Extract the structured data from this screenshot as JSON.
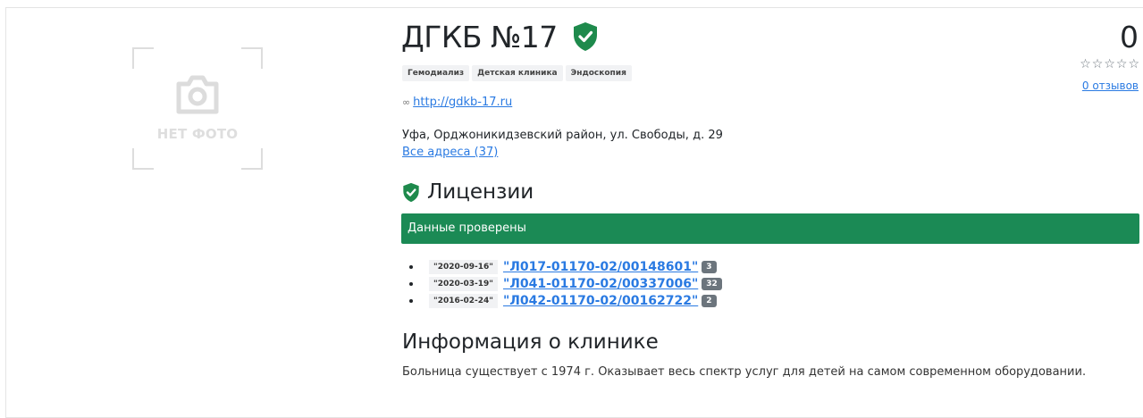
{
  "photo": {
    "placeholder_text": "НЕТ ФОТО",
    "icon": "camera-icon"
  },
  "clinic": {
    "name": "ДГКБ №17",
    "verified_icon": "shield-check-icon",
    "tags": [
      "Гемодиализ",
      "Детская клиника",
      "Эндоскопия"
    ],
    "website": "http://gdkb-17.ru",
    "address": "Уфа, Орджоникидзевский район, ул. Свободы, д. 29",
    "all_addresses_link": "Все адреса (37)"
  },
  "rating": {
    "score": "0",
    "stars_filled": 0,
    "stars_total": 5,
    "reviews_link": "0 отзывов"
  },
  "licenses": {
    "heading": "Лицензии",
    "verified_label": "Данные проверены",
    "items": [
      {
        "date": "\"2020-09-16\"",
        "number": "\"Л017-01170-02/00148601\"",
        "count": "3"
      },
      {
        "date": "\"2020-03-19\"",
        "number": "\"Л041-01170-02/00337006\"",
        "count": "32"
      },
      {
        "date": "\"2016-02-24\"",
        "number": "\"Л042-01170-02/00162722\"",
        "count": "2"
      }
    ]
  },
  "info": {
    "heading": "Информация о клинике",
    "text": "Больница существует с 1974 г. Оказывает весь спектр услуг для детей на самом современном оборудовании."
  },
  "colors": {
    "accent_green": "#1b8a55",
    "link_blue": "#2a7ae2",
    "shield_green": "#1e8a4c"
  }
}
